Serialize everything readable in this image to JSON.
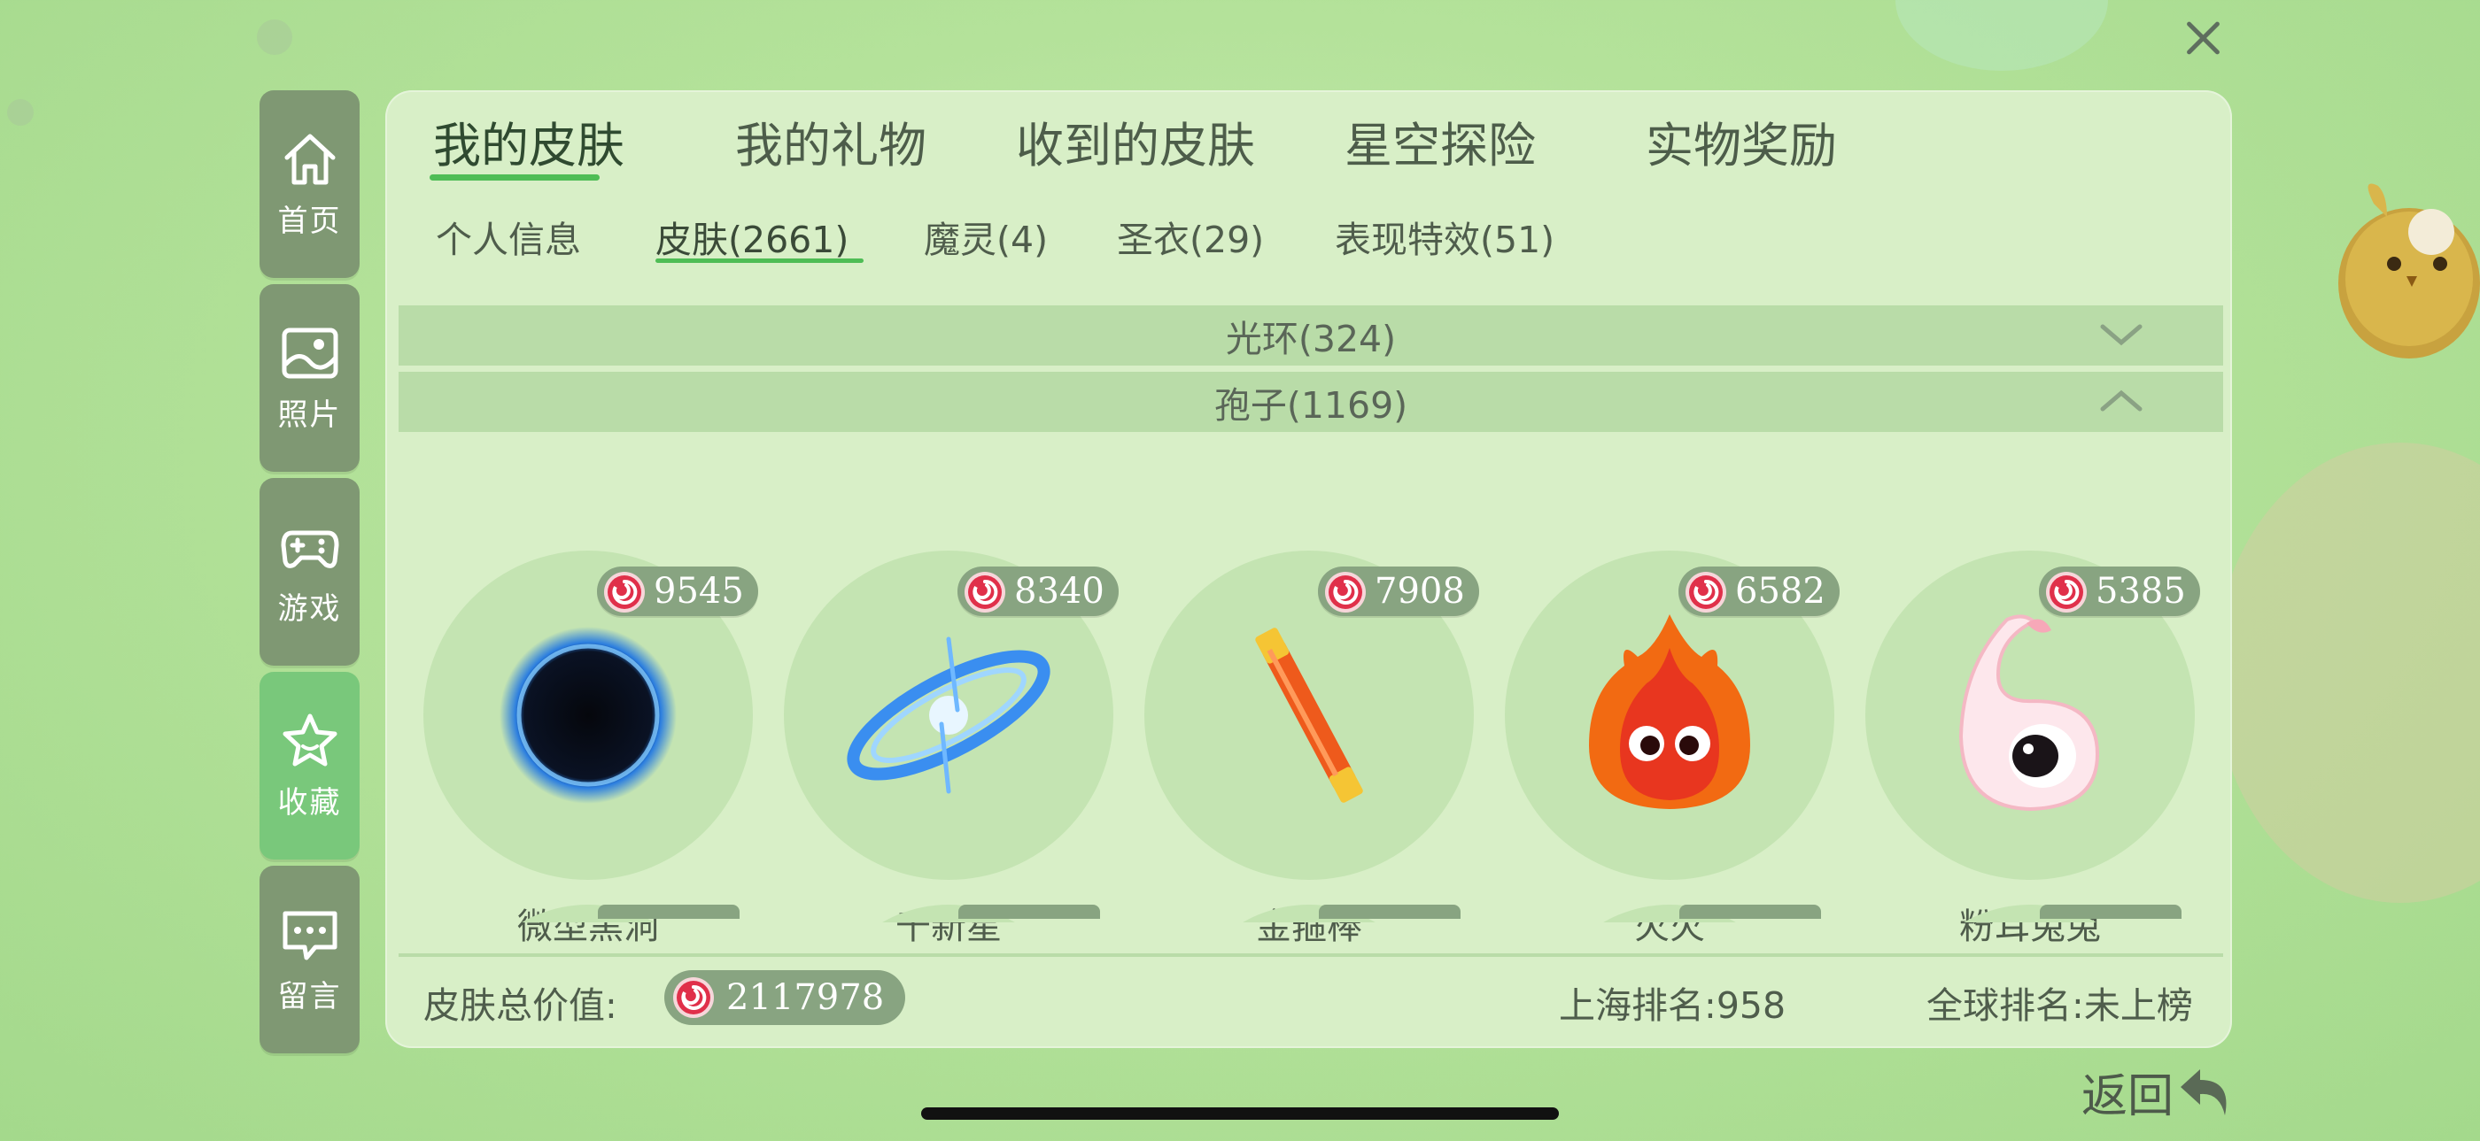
{
  "main_tabs": [
    {
      "label": "我的皮肤",
      "active": true
    },
    {
      "label": "我的礼物",
      "active": false
    },
    {
      "label": "收到的皮肤",
      "active": false
    },
    {
      "label": "星空探险",
      "active": false
    },
    {
      "label": "实物奖励",
      "active": false
    }
  ],
  "sub_tabs": [
    {
      "label": "个人信息",
      "active": false
    },
    {
      "label": "皮肤(2661)",
      "active": true
    },
    {
      "label": "魔灵(4)",
      "active": false
    },
    {
      "label": "圣衣(29)",
      "active": false
    },
    {
      "label": "表现特效(51)",
      "active": false
    }
  ],
  "sidebar": {
    "items": [
      {
        "label": "首页",
        "icon": "home-icon",
        "active": false
      },
      {
        "label": "照片",
        "icon": "photo-icon",
        "active": false
      },
      {
        "label": "游戏",
        "icon": "gamepad-icon",
        "active": false
      },
      {
        "label": "收藏",
        "icon": "star-icon",
        "active": true
      },
      {
        "label": "留言",
        "icon": "message-icon",
        "active": false
      }
    ]
  },
  "categories": [
    {
      "label": "光环(324)",
      "expanded": false
    },
    {
      "label": "孢子(1169)",
      "expanded": true
    }
  ],
  "items": [
    {
      "name": "微型黑洞",
      "price": "9545",
      "icon": "black-hole-icon"
    },
    {
      "name": "千新星",
      "price": "8340",
      "icon": "galaxy-icon"
    },
    {
      "name": "金箍棒",
      "price": "7908",
      "icon": "golden-staff-icon"
    },
    {
      "name": "火火",
      "price": "6582",
      "icon": "fire-creature-icon"
    },
    {
      "name": "粉耳兔兔",
      "price": "5385",
      "icon": "pink-ear-bunny-icon"
    }
  ],
  "footer": {
    "total_label": "皮肤总价值:",
    "total_value": "2117978",
    "shanghai_rank": "上海排名:958",
    "global_rank": "全球排名:未上榜"
  },
  "back_label": "返回",
  "colors": {
    "accent_green": "#4ebd55",
    "sidebar_bg": "#7f9873",
    "sidebar_active": "#79c87b",
    "panel_bg": "#d8efc7",
    "price_pill": "#88a481"
  }
}
